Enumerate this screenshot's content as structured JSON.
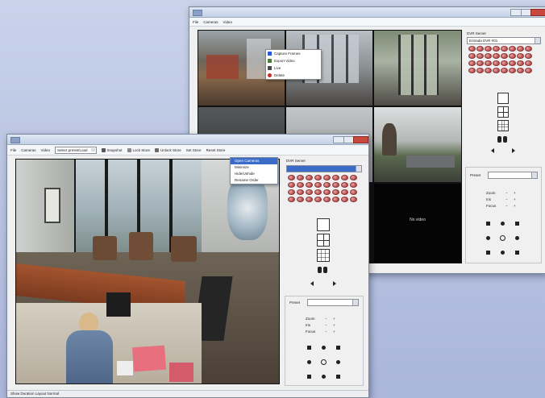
{
  "back_window": {
    "menu": [
      "File",
      "Cameras",
      "Video"
    ],
    "dvr_label": "DVR Server",
    "dvr_selected": "Entrada DVR #01",
    "context_menu": [
      {
        "label": "Capture Frames",
        "icon": "camera-icon",
        "color": "#2a5bd7"
      },
      {
        "label": "Export Video",
        "icon": "film-icon",
        "color": "#4b7a3c"
      },
      {
        "label": "Live",
        "icon": "live-icon",
        "color": "#4a4a4a"
      },
      {
        "label": "Delete",
        "icon": "delete-icon",
        "color": "#c0302a"
      }
    ],
    "preset_label": "Preset",
    "ptz": {
      "zoom": "Zoom",
      "iris": "Iris",
      "focus": "Focus",
      "minus": "−",
      "plus": "+"
    },
    "no_video_text": "No video"
  },
  "front_window": {
    "menu": [
      "File",
      "Cameras",
      "Video"
    ],
    "toolbar": {
      "combo": "Select preset/Load",
      "snapshot": "Snapshot",
      "lock": "Lock Store",
      "unlock": "Unlock Store",
      "set_store": "Set Store",
      "reset_store": "Reset Store"
    },
    "dropdown": [
      "Open Cameras",
      "Minimize",
      "Hide/Unhide",
      "Rename Order"
    ],
    "dropdown_highlighted": 0,
    "dvr_label": "DVR Server",
    "preset_label": "Preset",
    "ptz": {
      "zoom": "Zoom",
      "iris": "Iris",
      "focus": "Focus",
      "minus": "−",
      "plus": "+"
    },
    "status": "Show Duration   Layout Normal"
  },
  "colors": {
    "accent": "#3a6bc7",
    "camera_button": "#c25757",
    "desktop": "#b9c4e2"
  }
}
